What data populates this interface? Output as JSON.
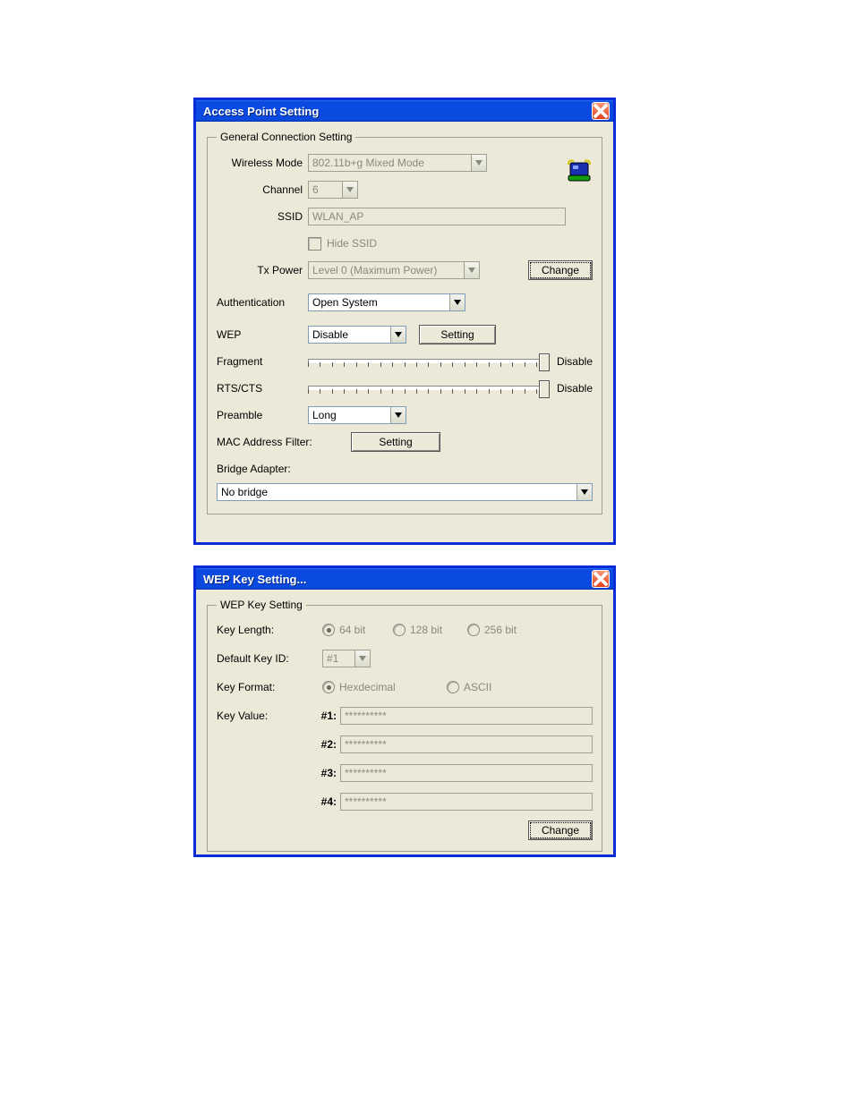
{
  "window1": {
    "title": "Access Point Setting",
    "group_title": "General Connection Setting",
    "labels": {
      "wireless_mode": "Wireless Mode",
      "channel": "Channel",
      "ssid": "SSID",
      "hide_ssid": "Hide SSID",
      "tx_power": "Tx Power",
      "authentication": "Authentication",
      "wep": "WEP",
      "fragment": "Fragment",
      "rts": "RTS/CTS",
      "preamble": "Preamble",
      "mac_filter": "MAC Address Filter:",
      "bridge": "Bridge Adapter:"
    },
    "values": {
      "wireless_mode": "802.11b+g Mixed Mode",
      "channel": "6",
      "ssid": "WLAN_AP",
      "tx_power": "Level 0 (Maximum Power)",
      "authentication": "Open System",
      "wep": "Disable",
      "fragment_state": "Disable",
      "rts_state": "Disable",
      "preamble": "Long",
      "bridge": "No bridge"
    },
    "buttons": {
      "change": "Change",
      "wep_setting": "Setting",
      "mac_setting": "Setting"
    }
  },
  "window2": {
    "title": "WEP Key Setting...",
    "group_title": "WEP Key Setting",
    "labels": {
      "key_length": "Key Length:",
      "opt64": "64 bit",
      "opt128": "128 bit",
      "opt256": "256 bit",
      "default_key_id": "Default Key ID:",
      "key_format": "Key Format:",
      "fmt_hex": "Hexdecimal",
      "fmt_ascii": "ASCII",
      "key_value": "Key Value:",
      "k1": "#1:",
      "k2": "#2:",
      "k3": "#3:",
      "k4": "#4:"
    },
    "values": {
      "default_key_id": "#1",
      "key1": "**********",
      "key2": "**********",
      "key3": "**********",
      "key4": "**********"
    },
    "buttons": {
      "change": "Change"
    }
  }
}
